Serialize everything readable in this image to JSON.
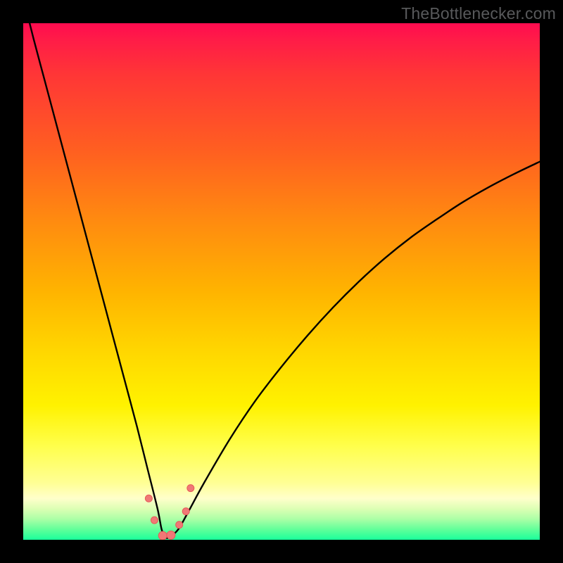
{
  "watermark": {
    "text": "TheBottlenecker.com"
  },
  "colors": {
    "curve": "#000000",
    "marker_fill": "#f07876",
    "marker_stroke": "#e65a58",
    "gradient_top": "#ff0b4f",
    "gradient_bottom": "#1aff9b",
    "frame": "#000000"
  },
  "chart_data": {
    "type": "line",
    "title": "",
    "xlabel": "",
    "ylabel": "",
    "xlim": [
      0,
      100
    ],
    "ylim": [
      0,
      100
    ],
    "grid": false,
    "legend": false,
    "annotations": [],
    "series": [
      {
        "name": "bottleneck-curve",
        "x": [
          0,
          2,
          4,
          6,
          8,
          10,
          12,
          14,
          16,
          18,
          20,
          22,
          24,
          26,
          26.8,
          27.5,
          28.3,
          30,
          32,
          35,
          40,
          45,
          50,
          55,
          60,
          65,
          70,
          75,
          80,
          85,
          90,
          95,
          100
        ],
        "y": [
          105,
          97,
          89.5,
          82,
          74.5,
          67,
          59.5,
          52,
          44.5,
          37,
          29.5,
          22,
          14,
          6,
          2,
          0.5,
          0.5,
          2,
          5.5,
          11,
          19.5,
          27,
          33.5,
          39.5,
          45,
          50,
          54.5,
          58.5,
          62,
          65.3,
          68.2,
          70.8,
          73.2
        ]
      }
    ],
    "markers": [
      {
        "x": 24.3,
        "y": 8.0,
        "r": 5
      },
      {
        "x": 25.4,
        "y": 3.8,
        "r": 5
      },
      {
        "x": 27.0,
        "y": 0.8,
        "r": 6
      },
      {
        "x": 28.6,
        "y": 0.9,
        "r": 6
      },
      {
        "x": 30.2,
        "y": 2.9,
        "r": 5
      },
      {
        "x": 31.5,
        "y": 5.5,
        "r": 5
      },
      {
        "x": 32.4,
        "y": 10.0,
        "r": 5
      }
    ]
  }
}
